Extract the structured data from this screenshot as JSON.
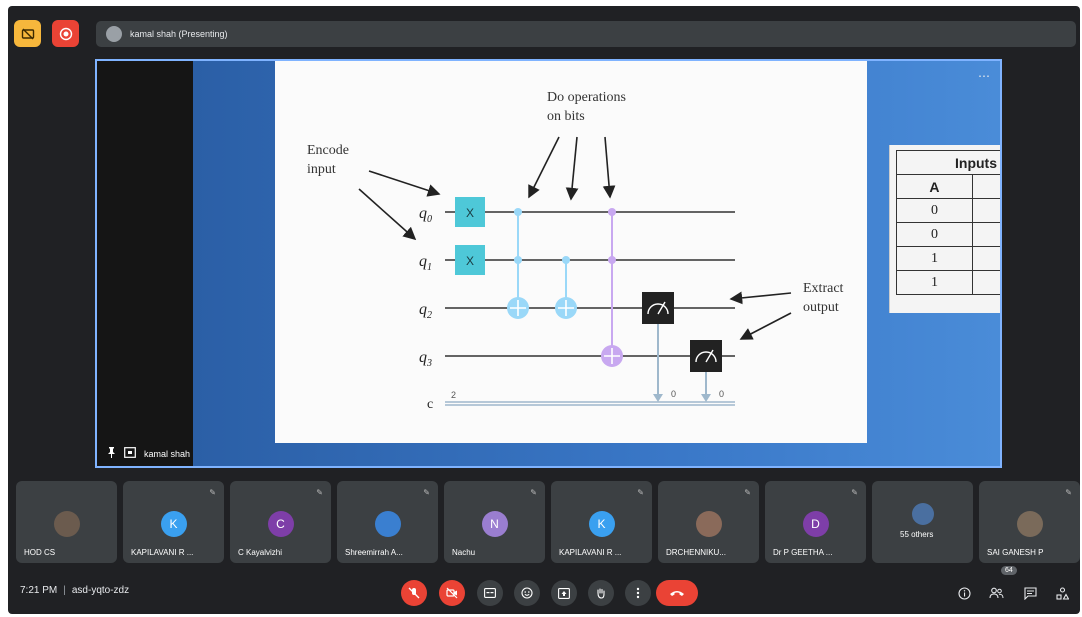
{
  "topbar": {
    "presenting_label": "kamal shah (Presenting)"
  },
  "stage": {
    "presenter_label": "kamal shah",
    "more_icon": "more-horizontal-icon"
  },
  "slide": {
    "encode_label": [
      "Encode",
      "input"
    ],
    "operations_label": [
      "Do operations",
      "on bits"
    ],
    "extract_label": [
      "Extract",
      "output"
    ],
    "qubits": [
      "q",
      "q",
      "q",
      "q"
    ],
    "qubit_subscripts": [
      "0",
      "1",
      "2",
      "3"
    ],
    "classical_label": "c",
    "classical_count": "2",
    "x_gate": "X",
    "measure_outputs": [
      "0",
      "0"
    ]
  },
  "truth_table": {
    "header": "Inputs",
    "column_a": "A",
    "rows": [
      "0",
      "0",
      "1",
      "1"
    ]
  },
  "participants": [
    {
      "name": "HOD CS",
      "initial": "",
      "color": "#6b5b4e"
    },
    {
      "name": "KAPILAVANI R ...",
      "initial": "K",
      "color": "#3aa0f0"
    },
    {
      "name": "C Kayalvizhi",
      "initial": "C",
      "color": "#7e3ea8"
    },
    {
      "name": "Shreemirrah A...",
      "initial": "",
      "color": "#3a7fd0"
    },
    {
      "name": "Nachu",
      "initial": "N",
      "color": "#9a7ed0"
    },
    {
      "name": "KAPILAVANI R ...",
      "initial": "K",
      "color": "#3aa0f0"
    },
    {
      "name": "DRCHENNIKU...",
      "initial": "",
      "color": "#8a6a5a"
    },
    {
      "name": "Dr P GEETHA ...",
      "initial": "D",
      "color": "#7e3ea8"
    },
    {
      "name": "55 others",
      "initial": "",
      "color": "#4a6fa0"
    },
    {
      "name": "SAI GANESH P",
      "initial": "",
      "color": "#7a6a5a"
    }
  ],
  "controlbar": {
    "time": "7:21 PM",
    "separator": "|",
    "meeting_code": "asd-yqto-zdz",
    "people_count": "64"
  },
  "colors": {
    "background": "#202124",
    "tile": "#3c4043",
    "danger": "#ea4335",
    "accent_yellow": "#f6b73c",
    "gate_teal": "#4ec8d8",
    "gate_blue": "#9ad8f8",
    "gate_purple": "#c8a8f0"
  }
}
